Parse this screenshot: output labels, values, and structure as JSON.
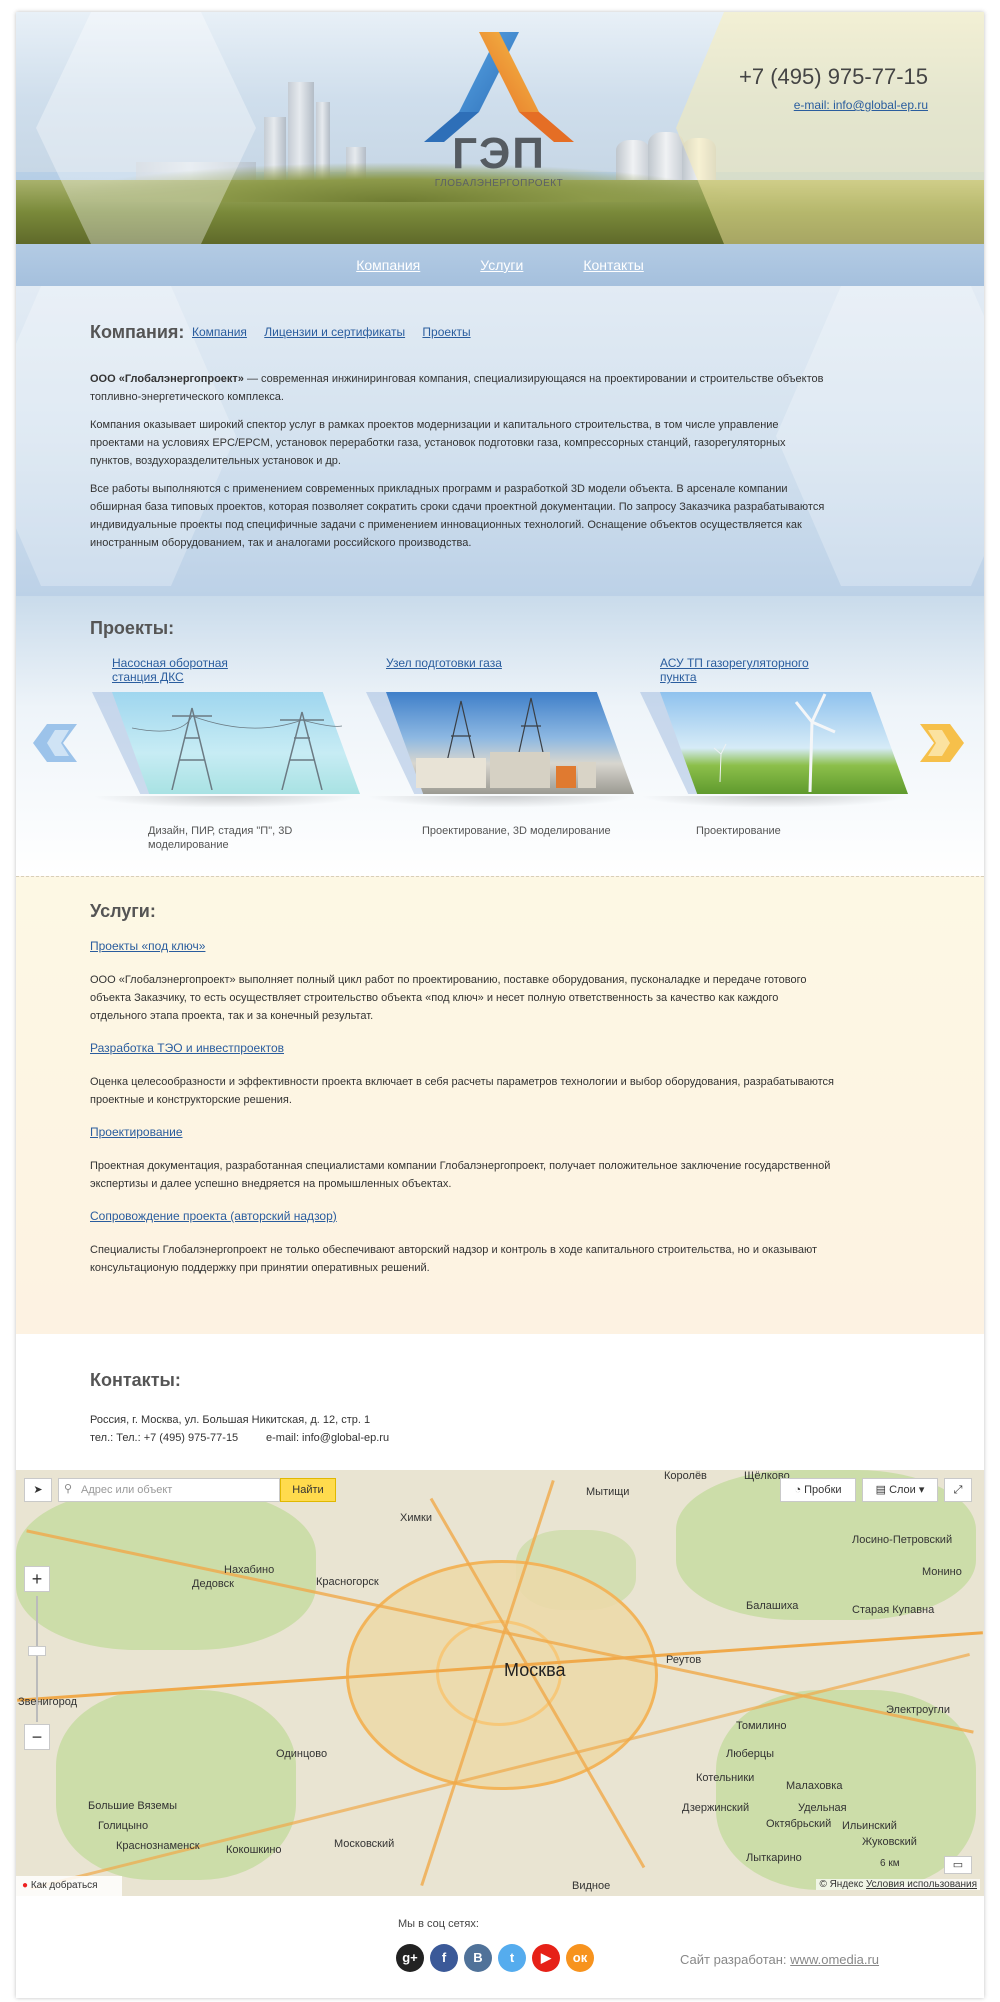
{
  "header": {
    "logo_text": "ГЭП",
    "logo_subtitle": "ГЛОБАЛЭНЕРГОПРОЕКТ",
    "phone": "+7 (495) 975-77-15",
    "email": "e-mail: info@global-ep.ru"
  },
  "nav": {
    "items": [
      "Компания",
      "Услуги",
      "Контакты"
    ]
  },
  "company": {
    "title": "Компания:",
    "links": [
      "Компания",
      "Лицензии и сертификаты",
      "Проекты"
    ],
    "p1_bold": "ООО «Глобалэнергопроект»",
    "p1_rest": " — современная инжиниринговая компания, специализирующаяся на проектировании и строительстве объектов топливно-энергетического комплекса.",
    "p2": "Компания оказывает широкий спектор услуг в рамках проектов модернизации и капитального строительства, в том числе управление проектами на условиях EPC/EPCM, установок переработки газа, установок подготовки газа, компрессорных станций, газорегуляторных пунктов, воздухоразделительных установок и др.",
    "p3": "Все работы выполняются с применением современных прикладных программ и разработкой 3D модели объекта. В арсенале компании обширная база типовых проектов, которая позволяет сократить сроки сдачи проектной документации. По запросу Заказчика разрабатываются индивидуальные проекты под специфичные задачи с применением инновационных технологий. Оснащение объектов осуществляется как иностранным оборудованием, так и аналогами российского производства."
  },
  "projects": {
    "title": "Проекты:",
    "items": [
      {
        "title": "Насосная оборотная станция ДКС",
        "caption": "Дизайн, ПИР, стадия \"П\", 3D моделирование"
      },
      {
        "title": "Узел подготовки газа",
        "caption": "Проектирование, 3D моделирование"
      },
      {
        "title": "АСУ ТП газорегуляторного пункта",
        "caption": "Проектирование"
      }
    ]
  },
  "services": {
    "title": "Услуги:",
    "items": [
      {
        "link": "Проекты «под ключ»",
        "text": "ООО «Глобалэнергопроект» выполняет полный цикл работ по проектированию, поставке оборудования, пусконаладке и передаче готового объекта Заказчику, то есть осуществляет строительство объекта «под ключ» и несет полную ответственность за качество как каждого отдельного этапа проекта, так и за конечный результат."
      },
      {
        "link": "Разработка ТЭО и инвестпроектов",
        "text": "Оценка целесообразности и эффективности проекта включает в себя расчеты параметров технологии и выбор оборудования, разрабатываются проектные и конструкторские решения."
      },
      {
        "link": "Проектирование",
        "text": "Проектная документация, разработанная специалистами компании Глобалэнергопроект, получает положительное заключение государственной экспертизы и далее успешно внедряется на промышленных объектах."
      },
      {
        "link": "Сопровождение проекта (авторский надзор)",
        "text": "Специалисты Глобалэнергопроект не только обеспечивают авторский надзор и контроль в ходе капитального строительства, но и оказывают консультационую поддержку при принятии оперативных решений."
      }
    ]
  },
  "contacts": {
    "title": "Контакты:",
    "address": "Россия, г. Москва, ул. Большая Никитская, д. 12, стр. 1",
    "phone": "тел.: Тел.: +7 (495) 975-77-15",
    "email": "e-mail: info@global-ep.ru"
  },
  "map": {
    "search_placeholder": "Адрес или объект",
    "find_button": "Найти",
    "traffic_button": "Пробки",
    "layers_button": "Слои",
    "route_label": "Как добраться",
    "scale_label": "6 км",
    "copyright": "© Яндекс",
    "terms": "Условия использования",
    "labels": {
      "moscow": "Москва",
      "khimki": "Химки",
      "mytishchi": "Мытищи",
      "korolyov": "Королёв",
      "shchyolkovo": "Щёлково",
      "krasnogorsk": "Красногорск",
      "nakhabino": "Нахабино",
      "dedovsk": "Дедовск",
      "zvenigorod": "Звенигород",
      "odintsovo": "Одинцово",
      "golitsyno": "Голицыно",
      "krasnoznamensk": "Краснознаменск",
      "kokoshkino": "Кокошкино",
      "moskovsky": "Московский",
      "reutov": "Реутов",
      "balashikha": "Балашиха",
      "lyubertsy": "Люберцы",
      "kotelniki": "Котельники",
      "dzerzhinsky": "Дзержинский",
      "malakhovka": "Малаховка",
      "losino": "Лосино-Петровский",
      "monino": "Монино",
      "staraya_kupavna": "Старая Купавна",
      "elektrougli": "Электроугли",
      "zhukovsky": "Жуковский",
      "vidnoe": "Видное",
      "bolshie_vyazemy": "Большие Вяземы",
      "oktyabrsky": "Октябрьский",
      "udelnaya": "Удельная",
      "ilyinsky": "Ильинский",
      "tomilino": "Томилино",
      "lytkarino": "Лыткарино"
    }
  },
  "footer": {
    "social_title": "Мы в соц сетях:",
    "social": [
      {
        "icon": "g+",
        "color": "#222222"
      },
      {
        "icon": "f",
        "color": "#3b5998"
      },
      {
        "icon": "В",
        "color": "#507299"
      },
      {
        "icon": "t",
        "color": "#55acee"
      },
      {
        "icon": "▶",
        "color": "#e62117"
      },
      {
        "icon": "ок",
        "color": "#f7931e"
      }
    ],
    "developer_text": "Сайт разработан:",
    "developer_link": "www.omedia.ru"
  }
}
